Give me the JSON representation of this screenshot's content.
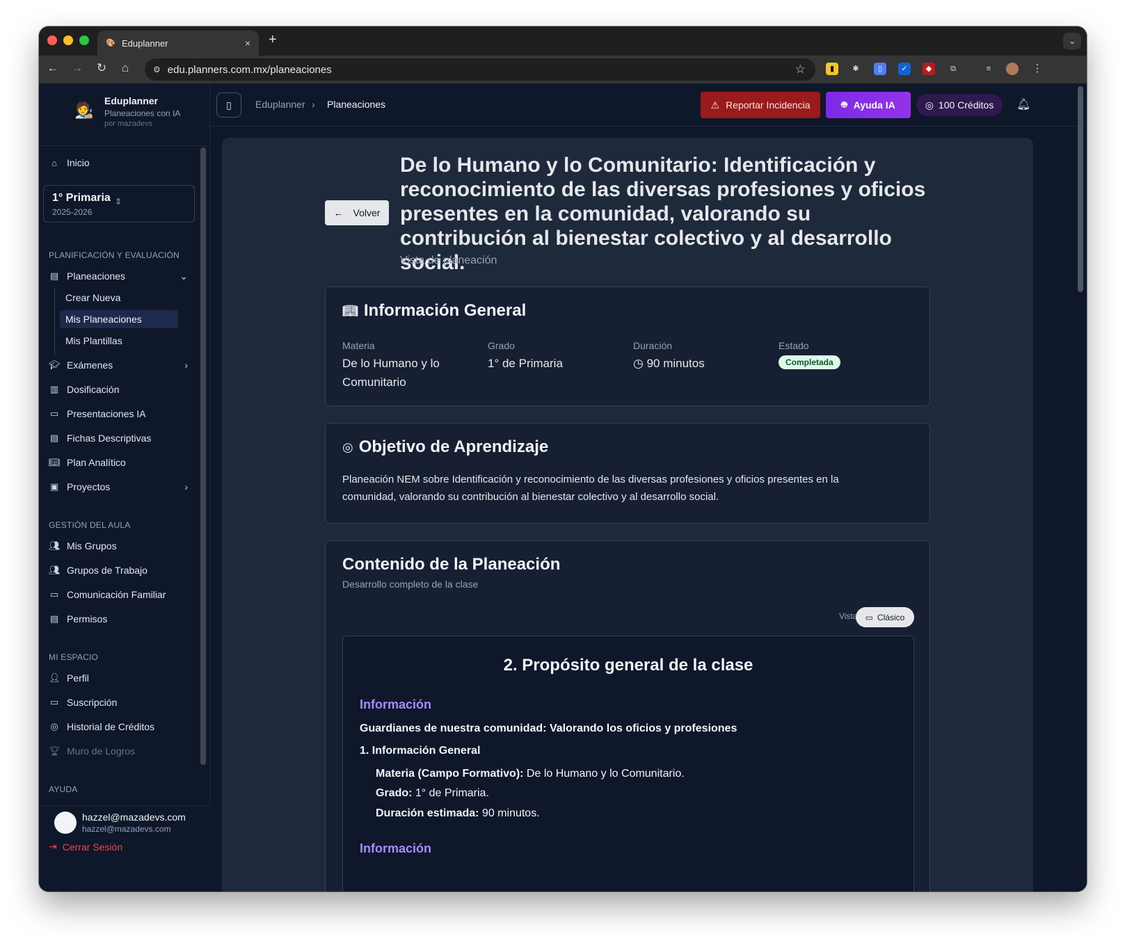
{
  "browser": {
    "tab_title": "Eduplanner",
    "tab_close": "×",
    "new_tab": "+",
    "url": "edu.planners.com.mx/planeaciones"
  },
  "sidebar": {
    "brand_name": "Eduplanner",
    "brand_tagline": "Planeaciones con IA",
    "brand_by": "por mazadevs",
    "home_label": "Inicio",
    "grade": {
      "title": "1° Primaria",
      "cycle": "2025-2026"
    },
    "section_planning": "PLANIFICACIÓN Y EVALUACIÓN",
    "planeaciones_label": "Planeaciones",
    "sub_items": [
      "Crear Nueva",
      "Mis Planeaciones",
      "Mis Plantillas"
    ],
    "active_sub_item": "Mis Planeaciones",
    "planning_items": [
      "Exámenes",
      "Dosificación",
      "Presentaciones IA",
      "Fichas Descriptivas",
      "Plan Analítico",
      "Proyectos"
    ],
    "section_classroom": "GESTIÓN DEL AULA",
    "classroom_items": [
      "Mis Grupos",
      "Grupos de Trabajo",
      "Comunicación Familiar",
      "Permisos"
    ],
    "section_space": "MI ESPACIO",
    "space_items": [
      "Perfil",
      "Suscripción",
      "Historial de Créditos",
      "Muro de Logros"
    ],
    "section_help": "AYUDA",
    "user_name": "hazzel@mazadevs.com",
    "user_email": "hazzel@mazadevs.com",
    "logout_label": "Cerrar Sesión"
  },
  "header": {
    "breadcrumb_root": "Eduplanner",
    "breadcrumb_current": "Planeaciones",
    "report_label": "Reportar Incidencia",
    "ai_help_label": "Ayuda IA",
    "credits_label": "100 Créditos"
  },
  "page": {
    "back_label": "Volver",
    "title": "De lo Humano y lo Comunitario: Identificación y reconocimiento de las diversas profesiones y oficios presentes en la comunidad, valorando su contribución al bienestar colectivo y al desarrollo social.",
    "subtitle": "Vista de planeación"
  },
  "general_info": {
    "title": "Información General",
    "materia_label": "Materia",
    "materia_value": "De lo Humano y lo Comunitario",
    "grado_label": "Grado",
    "grado_value": "1° de Primaria",
    "duracion_label": "Duración",
    "duracion_value": "90 minutos",
    "estado_label": "Estado",
    "estado_value": "Completada"
  },
  "objective": {
    "title": "Objetivo de Aprendizaje",
    "text": "Planeación NEM sobre Identificación y reconocimiento de las diversas profesiones y oficios presentes en la comunidad, valorando su contribución al bienestar colectivo y al desarrollo social."
  },
  "content": {
    "title": "Contenido de la Planeación",
    "subtitle": "Desarrollo completo de la clase",
    "view_label": "Vista:",
    "view_value": "Clásico",
    "section_title": "2. Propósito general de la clase",
    "info_heading": "Información",
    "lesson_title": "Guardianes de nuestra comunidad: Valorando los oficios y profesiones",
    "general_heading": "1. Información General",
    "materia_key": "Materia (Campo Formativo):",
    "materia_val": "De lo Humano y lo Comunitario.",
    "grado_key": "Grado:",
    "grado_val": "1° de Primaria.",
    "duracion_key": "Duración estimada:",
    "duracion_val": "90 minutos.",
    "info_heading_2": "Información"
  },
  "colors": {
    "app_bg": "#0f172a",
    "card_bg": "#1e293b",
    "report_red": "#991b1b",
    "ai_purple": "#9333ea",
    "info_violet": "#a78bfa",
    "badge_green": "#dcfce7"
  }
}
